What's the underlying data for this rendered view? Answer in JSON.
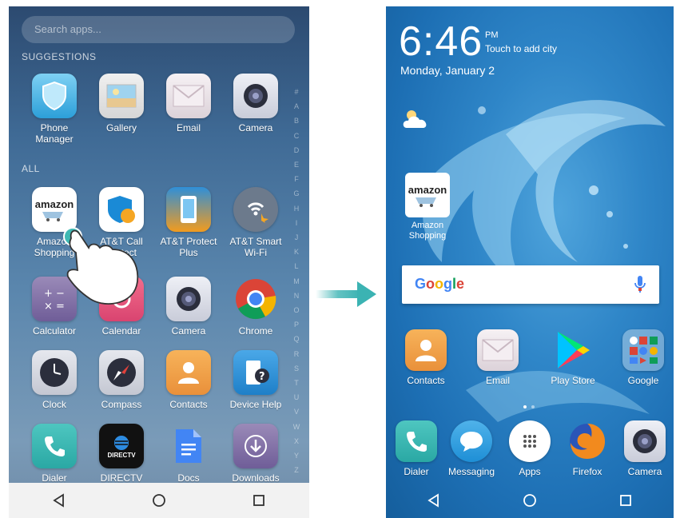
{
  "left_screen": {
    "search_placeholder": "Search apps...",
    "suggestions_label": "SUGGESTIONS",
    "all_label": "ALL",
    "suggestions": [
      {
        "label": "Phone\nManager",
        "icon": "shield-icon"
      },
      {
        "label": "Gallery",
        "icon": "gallery-icon"
      },
      {
        "label": "Email",
        "icon": "email-icon"
      },
      {
        "label": "Camera",
        "icon": "camera-icon"
      }
    ],
    "apps": [
      {
        "label": "Amazon\nShopping",
        "icon": "amazon-icon"
      },
      {
        "label": "AT&T Call\nProtect",
        "icon": "att-call-protect-icon"
      },
      {
        "label": "AT&T Protect\nPlus",
        "icon": "att-protect-plus-icon"
      },
      {
        "label": "AT&T Smart\nWi-Fi",
        "icon": "att-smart-wifi-icon"
      },
      {
        "label": "Calculator",
        "icon": "calculator-icon"
      },
      {
        "label": "Calendar",
        "icon": "calendar-icon"
      },
      {
        "label": "Camera",
        "icon": "camera-icon"
      },
      {
        "label": "Chrome",
        "icon": "chrome-icon"
      },
      {
        "label": "Clock",
        "icon": "clock-icon"
      },
      {
        "label": "Compass",
        "icon": "compass-icon"
      },
      {
        "label": "Contacts",
        "icon": "contacts-icon"
      },
      {
        "label": "Device Help",
        "icon": "device-help-icon"
      },
      {
        "label": "Dialer",
        "icon": "phone-icon"
      },
      {
        "label": "DIRECTV",
        "icon": "directv-icon"
      },
      {
        "label": "Docs",
        "icon": "docs-icon"
      },
      {
        "label": "Downloads",
        "icon": "download-icon"
      }
    ],
    "alpha_index": [
      "#",
      "A",
      "B",
      "C",
      "D",
      "E",
      "F",
      "G",
      "H",
      "I",
      "J",
      "K",
      "L",
      "M",
      "N",
      "O",
      "P",
      "Q",
      "R",
      "S",
      "T",
      "U",
      "V",
      "W",
      "X",
      "Y",
      "Z"
    ],
    "directv_text": "DIRECTV",
    "amazon_text": "amazon"
  },
  "right_screen": {
    "time": "6:46",
    "ampm": "PM",
    "add_city": "Touch to add city",
    "date": "Monday, January 2",
    "amazon_label": "Amazon\nShopping",
    "amazon_text": "amazon",
    "google_logo": "Google",
    "dock_row1": [
      {
        "label": "Contacts",
        "icon": "contacts-icon"
      },
      {
        "label": "Email",
        "icon": "email-icon"
      },
      {
        "label": "Play Store",
        "icon": "play-store-icon"
      },
      {
        "label": "Google",
        "icon": "google-folder-icon"
      }
    ],
    "dock_row2": [
      {
        "label": "Dialer",
        "icon": "phone-icon"
      },
      {
        "label": "Messaging",
        "icon": "messaging-icon"
      },
      {
        "label": "Apps",
        "icon": "apps-icon"
      },
      {
        "label": "Firefox",
        "icon": "firefox-icon"
      },
      {
        "label": "Camera",
        "icon": "camera-icon"
      }
    ]
  },
  "colors": {
    "arrow": "#3bb3b3",
    "navbar": "#f2f2f2"
  }
}
